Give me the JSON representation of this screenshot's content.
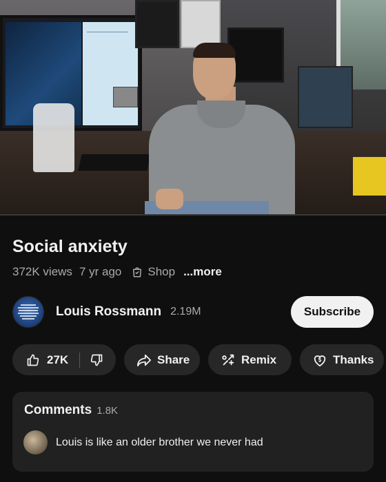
{
  "video": {
    "progress_fraction": 0.0
  },
  "title": "Social anxiety",
  "meta": {
    "views": "372K views",
    "age": "7 yr ago",
    "shop_label": "Shop",
    "more_label": "...more",
    "shop_icon": "shopping-bag-icon"
  },
  "channel": {
    "name": "Louis Rossmann",
    "subscribers": "2.19M",
    "subscribe_label": "Subscribe"
  },
  "actions": {
    "like_count": "27K",
    "like_icon": "thumb-up-icon",
    "dislike_icon": "thumb-down-icon",
    "share_label": "Share",
    "share_icon": "share-arrow-icon",
    "remix_label": "Remix",
    "remix_icon": "remix-icon",
    "thanks_label": "Thanks",
    "thanks_icon": "thanks-heart-icon"
  },
  "comments": {
    "title": "Comments",
    "count": "1.8K",
    "top_comment": "Louis is like an older brother we never had"
  },
  "colors": {
    "background": "#0f0f0f",
    "pill_bg": "#272727",
    "card_bg": "#212121",
    "subscribe_bg": "#f1f1f1",
    "progress": "#ff0000"
  }
}
